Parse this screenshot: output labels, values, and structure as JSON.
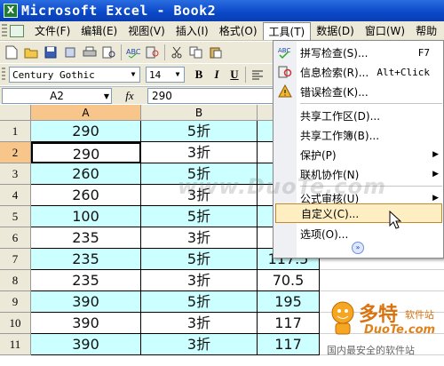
{
  "window": {
    "title": "Microsoft Excel - Book2",
    "app_icon": "X"
  },
  "menubar": {
    "items": [
      "文件(F)",
      "编辑(E)",
      "视图(V)",
      "插入(I)",
      "格式(O)",
      "工具(T)",
      "数据(D)",
      "窗口(W)",
      "帮助"
    ],
    "active_index": 5
  },
  "toolbar": {
    "font_name": "Century Gothic",
    "font_size": "14",
    "bold_label": "B",
    "italic_label": "I",
    "underline_label": "U"
  },
  "formula_bar": {
    "name_box": "A2",
    "fx_label": "fx",
    "value": "290"
  },
  "grid": {
    "columns": [
      "A",
      "B"
    ],
    "selected_column": "A",
    "rows": [
      {
        "n": "1",
        "a": "290",
        "b": "5折",
        "c": ""
      },
      {
        "n": "2",
        "a": "290",
        "b": "3折",
        "c": ""
      },
      {
        "n": "3",
        "a": "260",
        "b": "5折",
        "c": ""
      },
      {
        "n": "4",
        "a": "260",
        "b": "3折",
        "c": ""
      },
      {
        "n": "5",
        "a": "100",
        "b": "5折",
        "c": ""
      },
      {
        "n": "6",
        "a": "235",
        "b": "3折",
        "c": ""
      },
      {
        "n": "7",
        "a": "235",
        "b": "5折",
        "c": "117.5"
      },
      {
        "n": "8",
        "a": "235",
        "b": "3折",
        "c": "70.5"
      },
      {
        "n": "9",
        "a": "390",
        "b": "5折",
        "c": "195"
      },
      {
        "n": "10",
        "a": "390",
        "b": "3折",
        "c": "117"
      },
      {
        "n": "11",
        "a": "390",
        "b": "3折",
        "c": "117"
      }
    ],
    "selected_row": "2"
  },
  "tools_menu": {
    "items": [
      {
        "label": "拼写检查(S)...",
        "shortcut": "F7",
        "icon": "spellcheck-icon"
      },
      {
        "label": "信息检索(R)...",
        "shortcut": "Alt+Click",
        "icon": "research-icon"
      },
      {
        "label": "错误检查(K)...",
        "shortcut": "",
        "icon": "error-check-icon"
      },
      {
        "label": "共享工作区(D)...",
        "shortcut": ""
      },
      {
        "label": "共享工作簿(B)...",
        "shortcut": ""
      },
      {
        "label": "保护(P)",
        "shortcut": "",
        "submenu": true
      },
      {
        "label": "联机协作(N)",
        "shortcut": "",
        "submenu": true
      },
      {
        "label": "公式审核(U)",
        "shortcut": "",
        "submenu": true
      },
      {
        "label": "自定义(C)...",
        "shortcut": ""
      },
      {
        "label": "选项(O)...",
        "shortcut": ""
      }
    ],
    "highlighted_index": 8
  },
  "watermark": {
    "center": "www.DuoTe.com",
    "logo_cn": "多特",
    "logo_cn_small": "软件站",
    "logo_en": "DuoTe.com",
    "tagline": "国内最安全的软件站"
  },
  "colors": {
    "cyan_cell": "#ccffff",
    "selected_header": "#f8c58a",
    "menu_highlight": "#ffeec2",
    "title_bar": "#0a47c8"
  }
}
